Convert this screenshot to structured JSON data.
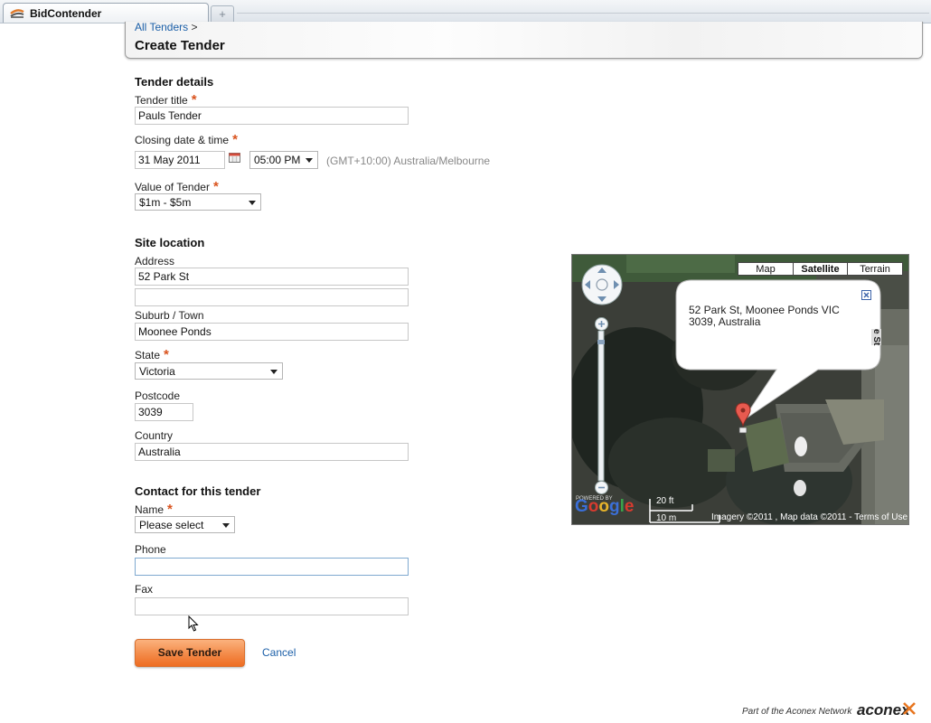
{
  "browser": {
    "tab_title": "BidContender",
    "new_tab_symbol": "+"
  },
  "header": {
    "breadcrumb_link": "All Tenders",
    "breadcrumb_sep": ">",
    "page_title": "Create Tender"
  },
  "tender_details": {
    "heading": "Tender details",
    "title_label": "Tender title",
    "title_value": "Pauls Tender",
    "closing_label": "Closing date & time",
    "closing_date": "31 May 2011",
    "closing_time": "05:00 PM",
    "timezone": "(GMT+10:00) Australia/Melbourne",
    "value_label": "Value of Tender",
    "value_selected": "$1m - $5m",
    "required_mark": "*"
  },
  "site_location": {
    "heading": "Site location",
    "address_label": "Address",
    "address_line1": "52 Park St",
    "address_line2": "",
    "suburb_label": "Suburb / Town",
    "suburb_value": "Moonee Ponds",
    "state_label": "State",
    "state_selected": "Victoria",
    "postcode_label": "Postcode",
    "postcode_value": "3039",
    "country_label": "Country",
    "country_value": "Australia"
  },
  "contact": {
    "heading": "Contact for this tender",
    "name_label": "Name",
    "name_selected": "Please select",
    "phone_label": "Phone",
    "phone_value": "",
    "fax_label": "Fax",
    "fax_value": ""
  },
  "actions": {
    "save_label": "Save Tender",
    "cancel_label": "Cancel"
  },
  "map": {
    "type_buttons": [
      "Map",
      "Satellite",
      "Terrain"
    ],
    "active_type": "Satellite",
    "info_text": "52 Park St, Moonee Ponds VIC 3039, Australia",
    "scale_top": "20 ft",
    "scale_bottom": "10 m",
    "logo": "Google",
    "powered_by": "POWERED BY",
    "attribution": "Imagery ©2011 , Map data ©2011 - Terms of Use",
    "street_label_fragment": "e St"
  },
  "footer": {
    "text": "Part of the Aconex Network",
    "logo": "aconex"
  },
  "colors": {
    "link": "#1b5fa8",
    "required": "#d9531e",
    "save_button": "#f38a48"
  },
  "icons": [
    "calendar-icon",
    "pan-control-icon",
    "zoom-in-icon",
    "zoom-out-icon",
    "map-marker-icon",
    "close-icon",
    "mouse-cursor-icon",
    "bidcontender-logo-icon"
  ]
}
